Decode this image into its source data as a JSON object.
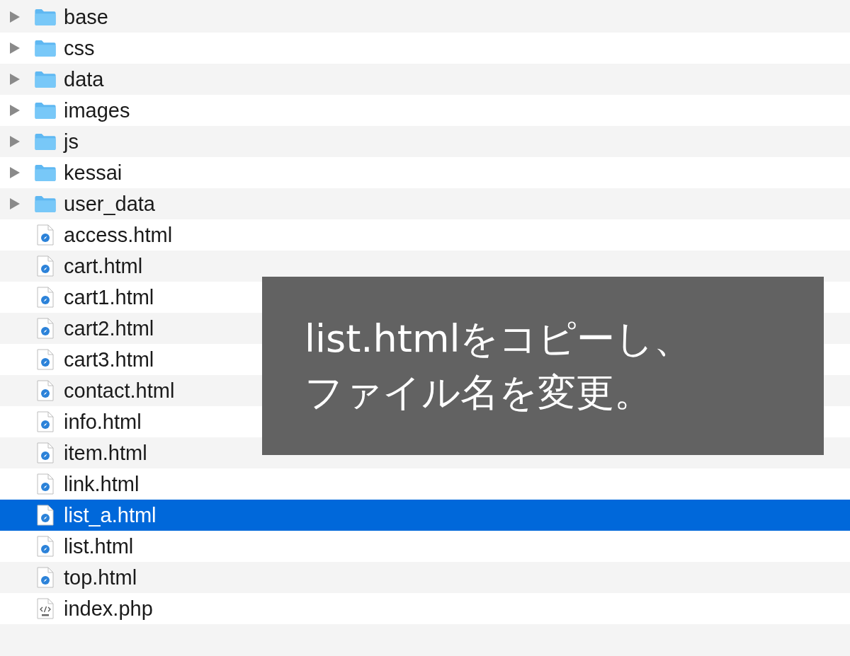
{
  "files": [
    {
      "name": "base",
      "kind": "folder",
      "expanded": false,
      "selected": false
    },
    {
      "name": "css",
      "kind": "folder",
      "expanded": false,
      "selected": false
    },
    {
      "name": "data",
      "kind": "folder",
      "expanded": false,
      "selected": false
    },
    {
      "name": "images",
      "kind": "folder",
      "expanded": false,
      "selected": false
    },
    {
      "name": "js",
      "kind": "folder",
      "expanded": false,
      "selected": false
    },
    {
      "name": "kessai",
      "kind": "folder",
      "expanded": false,
      "selected": false
    },
    {
      "name": "user_data",
      "kind": "folder",
      "expanded": false,
      "selected": false
    },
    {
      "name": "access.html",
      "kind": "html",
      "selected": false
    },
    {
      "name": "cart.html",
      "kind": "html",
      "selected": false
    },
    {
      "name": "cart1.html",
      "kind": "html",
      "selected": false
    },
    {
      "name": "cart2.html",
      "kind": "html",
      "selected": false
    },
    {
      "name": "cart3.html",
      "kind": "html",
      "selected": false
    },
    {
      "name": "contact.html",
      "kind": "html",
      "selected": false
    },
    {
      "name": "info.html",
      "kind": "html",
      "selected": false
    },
    {
      "name": "item.html",
      "kind": "html",
      "selected": false
    },
    {
      "name": "link.html",
      "kind": "html",
      "selected": false
    },
    {
      "name": "list_a.html",
      "kind": "html",
      "selected": true
    },
    {
      "name": "list.html",
      "kind": "html",
      "selected": false
    },
    {
      "name": "top.html",
      "kind": "html",
      "selected": false
    },
    {
      "name": "index.php",
      "kind": "php",
      "selected": false
    }
  ],
  "caption": {
    "lines": [
      "list.htmlをコピーし、",
      "ファイル名を変更。"
    ]
  }
}
